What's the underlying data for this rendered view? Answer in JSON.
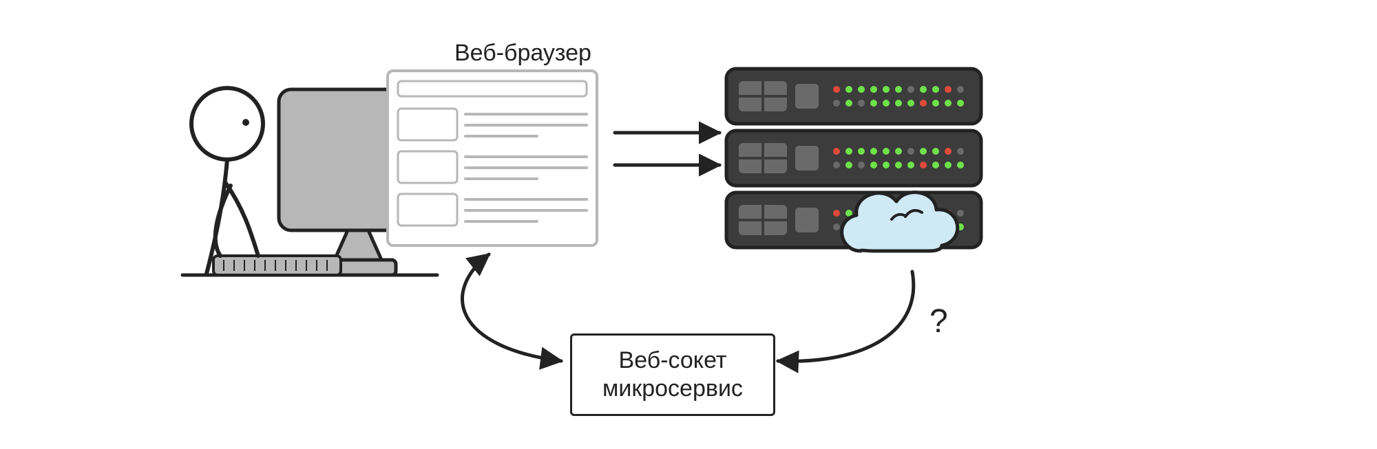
{
  "labels": {
    "browser": "Веб-браузер",
    "websocket_line1": "Веб-сокет",
    "websocket_line2": "микросервис",
    "question_mark": "?"
  },
  "entities": {
    "user_at_computer": "stick-figure person sitting at desktop computer",
    "browser_window": "wireframe of a web page in a browser window",
    "server_rack": "three stacked rack servers with blinking LEDs and a cloud in front",
    "websocket_service": "box labelled websocket microservice"
  },
  "arrows": [
    {
      "from": "browser_window",
      "to": "server_rack",
      "style": "request (right)"
    },
    {
      "from": "server_rack",
      "to": "browser_window",
      "style": "response (left)"
    },
    {
      "from": "browser_window",
      "to": "websocket_service",
      "style": "curved double-headed"
    },
    {
      "from": "server_rack",
      "to": "websocket_service",
      "style": "curved single-headed, annotated '?'"
    }
  ],
  "colors": {
    "ink": "#222222",
    "grey_fill": "#b7b7b7",
    "grey_dark": "#3c3c3c",
    "grey_mid": "#6a6a6a",
    "led_green": "#6fe24a",
    "led_red": "#e04a3a",
    "cloud_fill": "#cfe9f5"
  }
}
